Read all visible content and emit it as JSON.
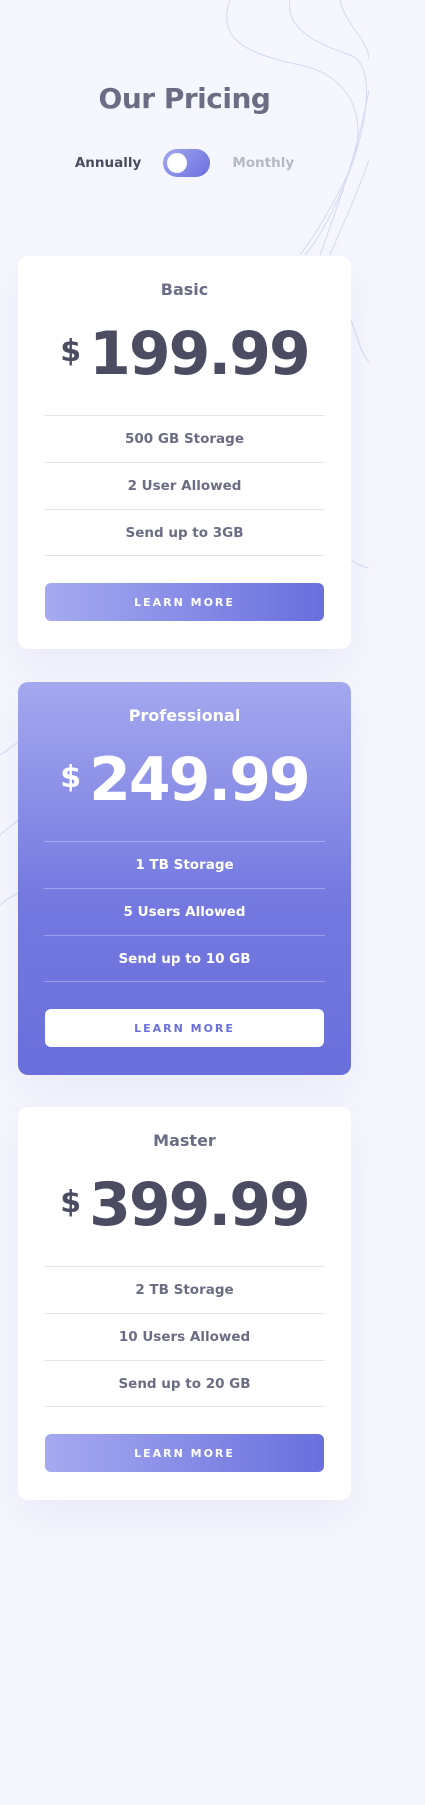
{
  "header": {
    "title": "Our Pricing"
  },
  "billing_toggle": {
    "left_label": "Annually",
    "right_label": "Monthly",
    "selected": "Annually"
  },
  "plans": [
    {
      "name": "Basic",
      "currency": "$",
      "price": "199.99",
      "features": [
        "500 GB Storage",
        "2 User Allowed",
        "Send up to 3GB"
      ],
      "button_label": "LEARN MORE",
      "featured": false
    },
    {
      "name": "Professional",
      "currency": "$",
      "price": "249.99",
      "features": [
        "1 TB Storage",
        "5 Users Allowed",
        "Send up to 10 GB"
      ],
      "button_label": "LEARN MORE",
      "featured": true
    },
    {
      "name": "Master",
      "currency": "$",
      "price": "399.99",
      "features": [
        "2 TB Storage",
        "10 Users Allowed",
        "Send up to 20 GB"
      ],
      "button_label": "LEARN MORE",
      "featured": false
    }
  ],
  "colors": {
    "background": "#f6f6fe",
    "heading": "#6b6d85",
    "price_text": "#4b4c62",
    "accent_start": "#a3a8f0",
    "accent_end": "#696fdd",
    "muted": "#b6b8c8"
  }
}
